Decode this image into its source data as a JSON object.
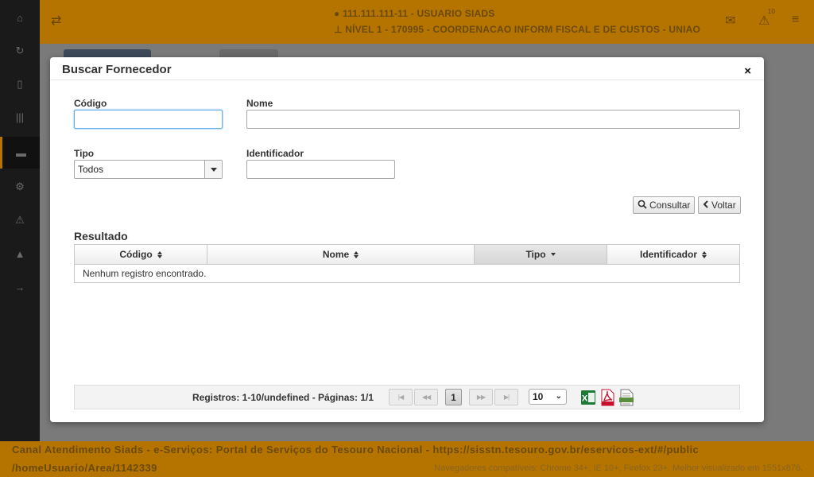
{
  "header": {
    "user": "111.111.111-11 - USUARIO SIADS",
    "unit": "NÍVEL 1 - 170995 - COORDENACAO INFORM FISCAL E DE CUSTOS - UNIAO",
    "notification_count": "10"
  },
  "footer": {
    "line1": "Canal Atendimento Siads - e-Serviços: Portal de Serviços do Tesouro Nacional - https://sisstn.tesouro.gov.br/eservicos-ext/#/public",
    "line2": "/homeUsuario/Area/1142339",
    "compat": "Navegadores compatíveis: Chrome 34+, IE 10+, Firefox 23+. Melhor visualizado em 1551x876."
  },
  "modal": {
    "title": "Buscar Fornecedor",
    "close_label": "×",
    "fields": {
      "codigo_label": "Código",
      "codigo_value": "",
      "nome_label": "Nome",
      "nome_value": "",
      "tipo_label": "Tipo",
      "tipo_value": "Todos",
      "identificador_label": "Identificador",
      "identificador_value": ""
    },
    "buttons": {
      "consultar": "Consultar",
      "voltar": "Voltar"
    },
    "result": {
      "title": "Resultado",
      "columns": [
        "Código",
        "Nome",
        "Tipo",
        "Identificador"
      ],
      "sorted_column": "Tipo",
      "empty_message": "Nenhum registro encontrado."
    },
    "paginator": {
      "info": "Registros: 1-10/undefined - Páginas: 1/1",
      "current_page": "1",
      "rows_per_page": "10"
    }
  },
  "colors": {
    "accent": "#b57400",
    "sidebar": "#1a1a1a"
  }
}
